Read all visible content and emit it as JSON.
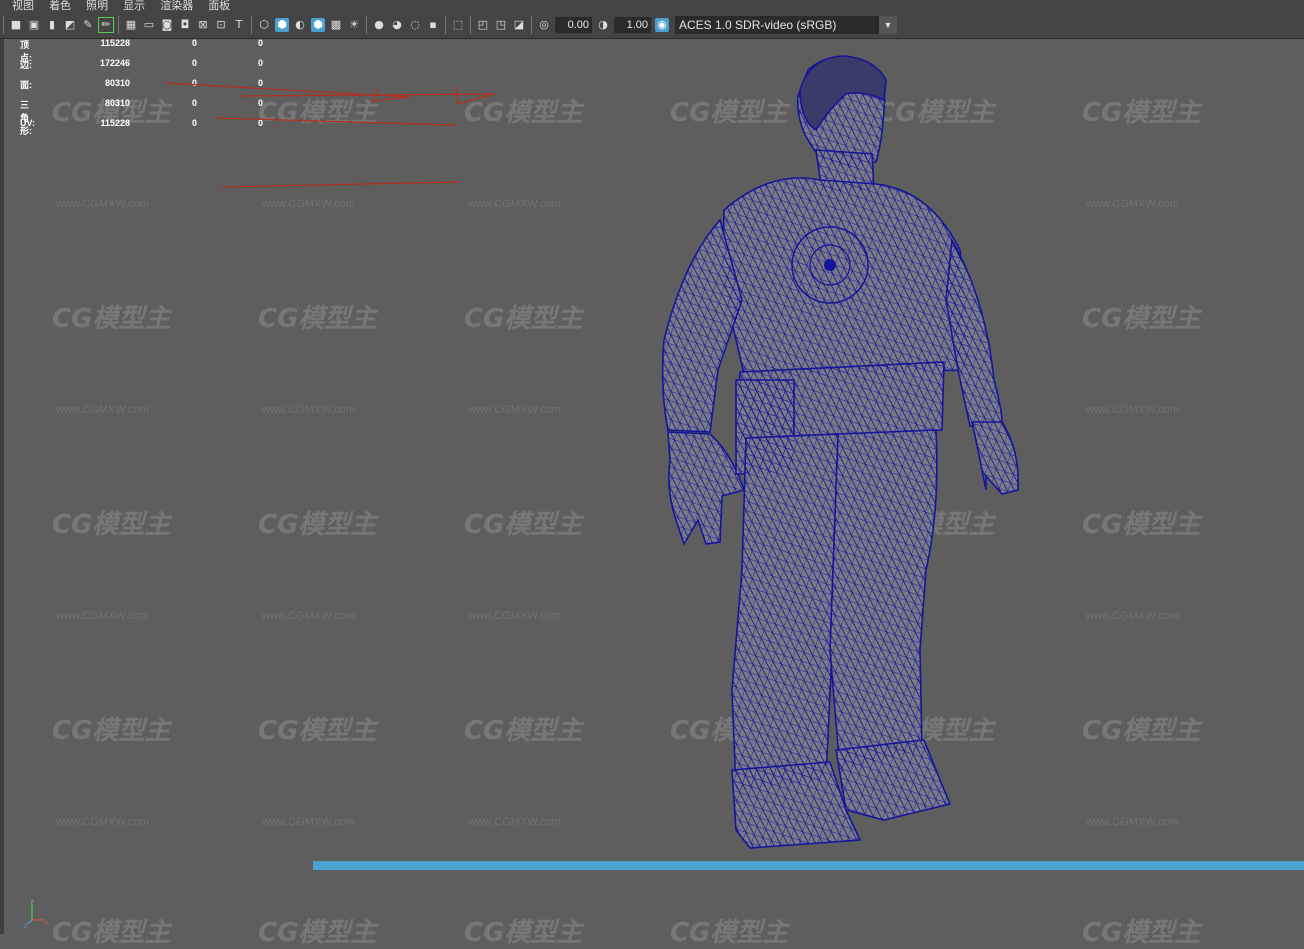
{
  "menu": [
    "视图",
    "着色",
    "照明",
    "显示",
    "渲染器",
    "面板"
  ],
  "toolbar": {
    "exposure_value": "0.00",
    "gamma_value": "1.00",
    "color_space": "ACES 1.0 SDR-video (sRGB)"
  },
  "hud": [
    {
      "label": "顶点:",
      "v1": "115228",
      "v2": "0",
      "v3": "0"
    },
    {
      "label": "边:",
      "v1": "172246",
      "v2": "0",
      "v3": "0"
    },
    {
      "label": "面:",
      "v1": "80310",
      "v2": "0",
      "v3": "0"
    },
    {
      "label": "三角形:",
      "v1": "80310",
      "v2": "0",
      "v3": "0"
    },
    {
      "label": "UV:",
      "v1": "115228",
      "v2": "0",
      "v3": "0"
    }
  ],
  "watermark": {
    "logo": "CG模型主",
    "url": "www.CGMXW.com"
  },
  "axis": {
    "x": "x",
    "y": "y",
    "z": "z"
  },
  "colors": {
    "viewport_bg": "#5e5e5e",
    "toolbar_bg": "#444444",
    "wireframe": "#15159a",
    "timeline": "#4aa3d1",
    "annotation_red": "#b3301f"
  }
}
